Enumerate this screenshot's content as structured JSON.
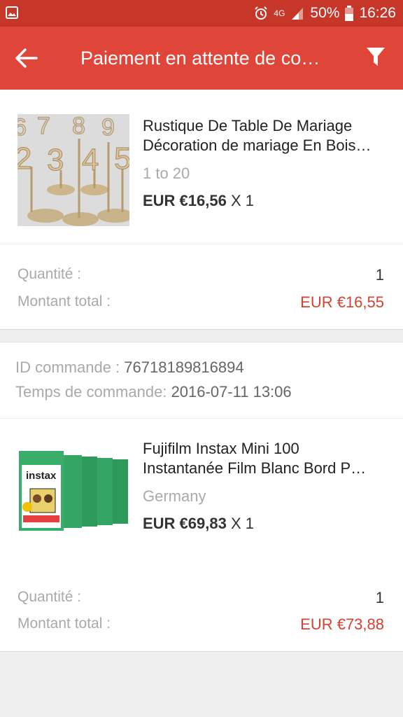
{
  "status_bar": {
    "battery": "50%",
    "time": "16:26",
    "network": "4G"
  },
  "header": {
    "title": "Paiement en attente de co…",
    "back_icon": "arrow-left-icon",
    "filter_icon": "filter-icon"
  },
  "orders": [
    {
      "product": {
        "title_line1": "Rustique De Table De Mariage",
        "title_line2": "Décoration de mariage En Bois…",
        "variant": "1 to 20",
        "price": "EUR €16,56",
        "qty_suffix": "X 1",
        "thumb_digits": [
          "2",
          "3",
          "4",
          "5",
          "6",
          "7",
          "8",
          "9"
        ]
      },
      "quantity_label": "Quantité :",
      "quantity_value": "1",
      "total_label": "Montant total :",
      "total_value": "EUR €16,55"
    },
    {
      "order_id_label": "ID commande :",
      "order_id_value": "76718189816894",
      "order_time_label": "Temps de commande:",
      "order_time_value": "2016-07-11 13:06",
      "product": {
        "title_line1": "Fujifilm Instax Mini 100",
        "title_line2": "Instantanée Film Blanc Bord P…",
        "variant": "Germany",
        "price": "EUR €69,83",
        "qty_suffix": "X 1",
        "thumb_brand": "instax"
      },
      "quantity_label": "Quantité :",
      "quantity_value": "1",
      "total_label": "Montant total :",
      "total_value": "EUR €73,88"
    }
  ],
  "colors": {
    "status_bar": "#c6372a",
    "app_bar": "#e0453a",
    "total_red": "#d9402f"
  }
}
